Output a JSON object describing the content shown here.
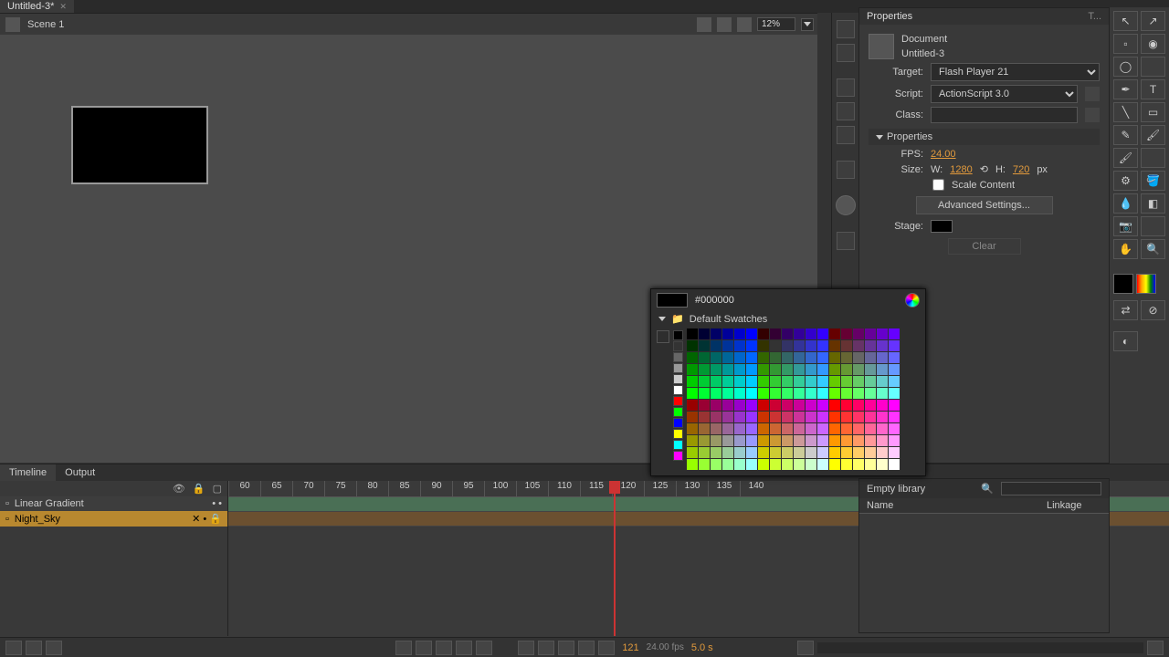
{
  "document": {
    "tab_title": "Untitled-3*",
    "scene": "Scene 1",
    "zoom": "12%"
  },
  "properties": {
    "panel_title": "Properties",
    "doc_label": "Document",
    "doc_name": "Untitled-3",
    "publish": {
      "target_label": "Target:",
      "target_value": "Flash Player 21",
      "script_label": "Script:",
      "script_value": "ActionScript 3.0",
      "class_label": "Class:"
    },
    "props_section": "Properties",
    "fps_label": "FPS:",
    "fps_value": "24.00",
    "size_label": "Size:",
    "w_label": "W:",
    "w_value": "1280",
    "h_label": "H:",
    "h_value": "720",
    "px_label": "px",
    "scale_label": "Scale Content",
    "advanced_label": "Advanced Settings...",
    "stage_label": "Stage:",
    "clear_label": "Clear"
  },
  "color_picker": {
    "hex": "#000000",
    "swatches_label": "Default Swatches"
  },
  "timeline": {
    "tab1": "Timeline",
    "tab2": "Output",
    "layer1": "Linear Gradient",
    "layer2": "Night_Sky",
    "ticks": [
      "60",
      "65",
      "70",
      "75",
      "80",
      "85",
      "90",
      "95",
      "100",
      "105",
      "110",
      "115",
      "120",
      "125",
      "130",
      "135",
      "140"
    ],
    "current_frame": "121",
    "fps_disp": "24.00 fps",
    "time_disp": "5.0 s"
  },
  "library": {
    "empty_label": "Empty library",
    "name_col": "Name",
    "linkage_col": "Linkage"
  },
  "side_tab": "T..."
}
